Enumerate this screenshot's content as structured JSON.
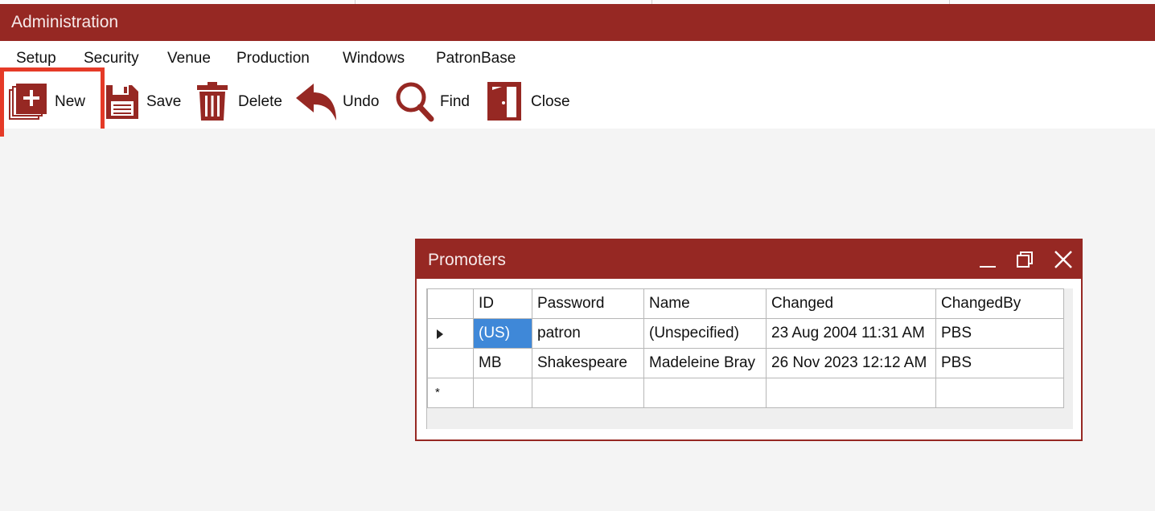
{
  "window": {
    "title": "Administration"
  },
  "menu": [
    "Setup",
    "Security",
    "Venue",
    "Production",
    "Windows",
    "PatronBase"
  ],
  "toolbar": {
    "new_label": "New",
    "save_label": "Save",
    "delete_label": "Delete",
    "undo_label": "Undo",
    "find_label": "Find",
    "close_label": "Close"
  },
  "colors": {
    "brand": "#962823",
    "highlight": "#e53a27",
    "selection": "#3f88d8"
  },
  "promoters": {
    "title": "Promoters",
    "columns": [
      "ID",
      "Password",
      "Name",
      "Changed",
      "ChangedBy"
    ],
    "rows": [
      [
        "(US)",
        "patron",
        "(Unspecified)",
        "23 Aug 2004 11:31 AM",
        "PBS"
      ],
      [
        "MB",
        "Shakespeare",
        "Madeleine Bray",
        "26 Nov 2023 12:12 AM",
        "PBS"
      ]
    ],
    "new_row_marker": "*"
  }
}
